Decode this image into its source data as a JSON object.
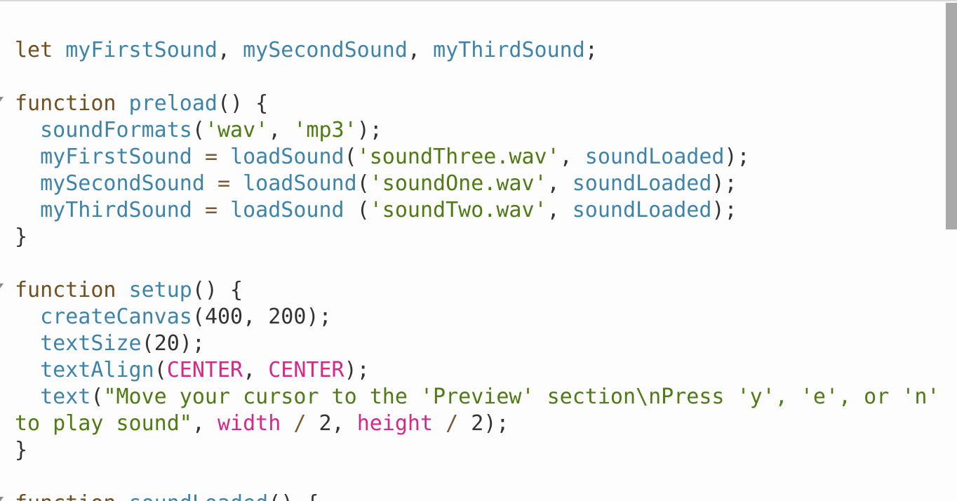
{
  "editor": {
    "lines": [
      [
        {
          "t": "kw",
          "v": "let"
        },
        {
          "t": "plain",
          "v": " "
        },
        {
          "t": "var",
          "v": "myFirstSound"
        },
        {
          "t": "plain",
          "v": ", "
        },
        {
          "t": "var",
          "v": "mySecondSound"
        },
        {
          "t": "plain",
          "v": ", "
        },
        {
          "t": "var",
          "v": "myThirdSound"
        },
        {
          "t": "plain",
          "v": ";"
        }
      ],
      [],
      [
        {
          "t": "kw",
          "v": "function"
        },
        {
          "t": "plain",
          "v": " "
        },
        {
          "t": "def",
          "v": "preload"
        },
        {
          "t": "plain",
          "v": "() {"
        }
      ],
      [
        {
          "t": "plain",
          "v": "  "
        },
        {
          "t": "fn",
          "v": "soundFormats"
        },
        {
          "t": "plain",
          "v": "("
        },
        {
          "t": "str",
          "v": "'wav'"
        },
        {
          "t": "plain",
          "v": ", "
        },
        {
          "t": "str",
          "v": "'mp3'"
        },
        {
          "t": "plain",
          "v": ");"
        }
      ],
      [
        {
          "t": "plain",
          "v": "  "
        },
        {
          "t": "var",
          "v": "myFirstSound"
        },
        {
          "t": "plain",
          "v": " "
        },
        {
          "t": "op",
          "v": "="
        },
        {
          "t": "plain",
          "v": " "
        },
        {
          "t": "fn",
          "v": "loadSound"
        },
        {
          "t": "plain",
          "v": "("
        },
        {
          "t": "str",
          "v": "'soundThree.wav'"
        },
        {
          "t": "plain",
          "v": ", "
        },
        {
          "t": "var",
          "v": "soundLoaded"
        },
        {
          "t": "plain",
          "v": ");"
        }
      ],
      [
        {
          "t": "plain",
          "v": "  "
        },
        {
          "t": "var",
          "v": "mySecondSound"
        },
        {
          "t": "plain",
          "v": " "
        },
        {
          "t": "op",
          "v": "="
        },
        {
          "t": "plain",
          "v": " "
        },
        {
          "t": "fn",
          "v": "loadSound"
        },
        {
          "t": "plain",
          "v": "("
        },
        {
          "t": "str",
          "v": "'soundOne.wav'"
        },
        {
          "t": "plain",
          "v": ", "
        },
        {
          "t": "var",
          "v": "soundLoaded"
        },
        {
          "t": "plain",
          "v": ");"
        }
      ],
      [
        {
          "t": "plain",
          "v": "  "
        },
        {
          "t": "var",
          "v": "myThirdSound"
        },
        {
          "t": "plain",
          "v": " "
        },
        {
          "t": "op",
          "v": "="
        },
        {
          "t": "plain",
          "v": " "
        },
        {
          "t": "fn",
          "v": "loadSound"
        },
        {
          "t": "plain",
          "v": " ("
        },
        {
          "t": "str",
          "v": "'soundTwo.wav'"
        },
        {
          "t": "plain",
          "v": ", "
        },
        {
          "t": "var",
          "v": "soundLoaded"
        },
        {
          "t": "plain",
          "v": ");"
        }
      ],
      [
        {
          "t": "plain",
          "v": "}"
        }
      ],
      [],
      [
        {
          "t": "kw",
          "v": "function"
        },
        {
          "t": "plain",
          "v": " "
        },
        {
          "t": "def",
          "v": "setup"
        },
        {
          "t": "plain",
          "v": "() {"
        }
      ],
      [
        {
          "t": "plain",
          "v": "  "
        },
        {
          "t": "fn",
          "v": "createCanvas"
        },
        {
          "t": "plain",
          "v": "("
        },
        {
          "t": "num",
          "v": "400"
        },
        {
          "t": "plain",
          "v": ", "
        },
        {
          "t": "num",
          "v": "200"
        },
        {
          "t": "plain",
          "v": ");"
        }
      ],
      [
        {
          "t": "plain",
          "v": "  "
        },
        {
          "t": "fn",
          "v": "textSize"
        },
        {
          "t": "plain",
          "v": "("
        },
        {
          "t": "num",
          "v": "20"
        },
        {
          "t": "plain",
          "v": ");"
        }
      ],
      [
        {
          "t": "plain",
          "v": "  "
        },
        {
          "t": "fn",
          "v": "textAlign"
        },
        {
          "t": "plain",
          "v": "("
        },
        {
          "t": "const",
          "v": "CENTER"
        },
        {
          "t": "plain",
          "v": ", "
        },
        {
          "t": "const",
          "v": "CENTER"
        },
        {
          "t": "plain",
          "v": ");"
        }
      ],
      [
        {
          "t": "plain",
          "v": "  "
        },
        {
          "t": "fn",
          "v": "text"
        },
        {
          "t": "plain",
          "v": "("
        },
        {
          "t": "str",
          "v": "\"Move your cursor to the 'Preview' section\\nPress 'y', 'e', or 'n'"
        }
      ],
      [
        {
          "t": "str",
          "v": "to play sound\""
        },
        {
          "t": "plain",
          "v": ", "
        },
        {
          "t": "const",
          "v": "width"
        },
        {
          "t": "plain",
          "v": " "
        },
        {
          "t": "op",
          "v": "/"
        },
        {
          "t": "plain",
          "v": " "
        },
        {
          "t": "num",
          "v": "2"
        },
        {
          "t": "plain",
          "v": ", "
        },
        {
          "t": "const",
          "v": "height"
        },
        {
          "t": "plain",
          "v": " "
        },
        {
          "t": "op",
          "v": "/"
        },
        {
          "t": "plain",
          "v": " "
        },
        {
          "t": "num",
          "v": "2"
        },
        {
          "t": "plain",
          "v": ");"
        }
      ],
      [
        {
          "t": "plain",
          "v": "}"
        }
      ],
      [],
      [
        {
          "t": "kw",
          "v": "function"
        },
        {
          "t": "plain",
          "v": " "
        },
        {
          "t": "def",
          "v": "soundLoaded"
        },
        {
          "t": "plain",
          "v": "() {"
        }
      ]
    ],
    "fold_lines": [
      2,
      9,
      17
    ]
  },
  "colors": {
    "keyword": "#704f21",
    "variable": "#3f84a8",
    "string": "#4f7a16",
    "constant": "#d52889",
    "plain": "#333333",
    "scrollbar_thumb": "#a9a9a9"
  },
  "scrollbar": {
    "position": 0.0
  }
}
